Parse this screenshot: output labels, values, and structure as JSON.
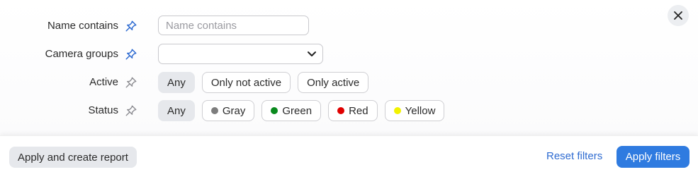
{
  "filters": {
    "name_contains": {
      "label": "Name contains",
      "placeholder": "Name contains",
      "value": "",
      "pinned": true
    },
    "camera_groups": {
      "label": "Camera groups",
      "value": "",
      "pinned": true
    },
    "active": {
      "label": "Active",
      "pinned": false,
      "options": [
        {
          "label": "Any",
          "selected": true
        },
        {
          "label": "Only not active",
          "selected": false
        },
        {
          "label": "Only active",
          "selected": false
        }
      ]
    },
    "status": {
      "label": "Status",
      "pinned": false,
      "options": [
        {
          "label": "Any",
          "selected": true,
          "color": null
        },
        {
          "label": "Gray",
          "selected": false,
          "color": "#7d7d7d"
        },
        {
          "label": "Green",
          "selected": false,
          "color": "#0a8a1e"
        },
        {
          "label": "Red",
          "selected": false,
          "color": "#e00000"
        },
        {
          "label": "Yellow",
          "selected": false,
          "color": "#f2f200"
        }
      ]
    }
  },
  "footer": {
    "create_report_label": "Apply and create report",
    "reset_label": "Reset filters",
    "apply_label": "Apply filters"
  },
  "colors": {
    "pin_active": "#2e6bd1",
    "pin_inactive": "#8b8b90",
    "accent": "#2f7be0",
    "link": "#2e6bd1"
  },
  "icons": {
    "pin": "pin-icon",
    "chevron": "chevron-down-icon",
    "close": "close-icon"
  }
}
